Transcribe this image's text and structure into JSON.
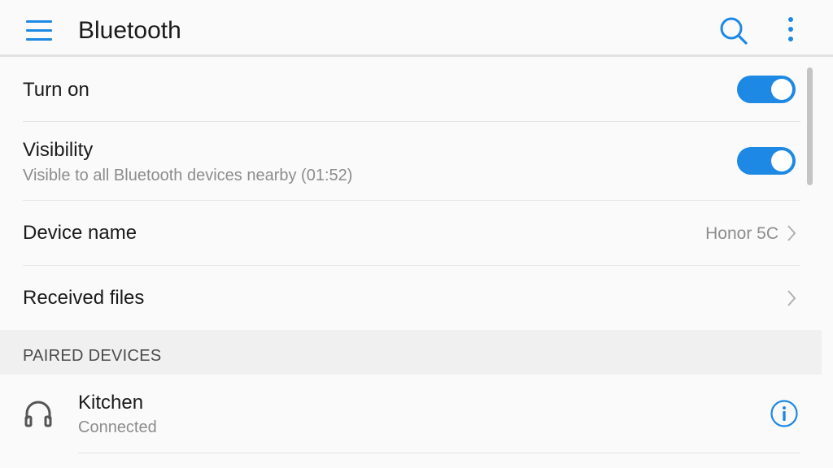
{
  "appbar": {
    "title": "Bluetooth",
    "menu_icon": "hamburger-menu-icon",
    "search_icon": "search-icon",
    "more_icon": "more-vertical-icon",
    "accent_color": "#1e88e5"
  },
  "settings": {
    "turn_on": {
      "label": "Turn on",
      "toggle_state": "on"
    },
    "visibility": {
      "label": "Visibility",
      "subtitle": "Visible to all Bluetooth devices nearby (01:52)",
      "toggle_state": "on"
    },
    "device_name": {
      "label": "Device name",
      "value": "Honor 5C"
    },
    "received_files": {
      "label": "Received files"
    }
  },
  "paired": {
    "header": "PAIRED DEVICES",
    "devices": [
      {
        "name": "Kitchen",
        "status": "Connected",
        "icon": "headphones-icon",
        "action_icon": "info-icon"
      }
    ]
  }
}
